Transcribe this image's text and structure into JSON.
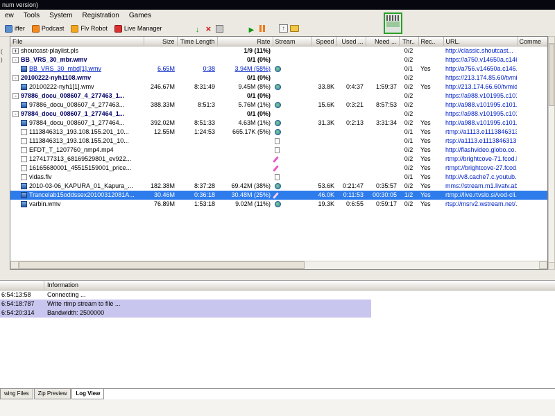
{
  "window": {
    "title": "num version)"
  },
  "menu": {
    "items": [
      "ew",
      "Tools",
      "System",
      "Registration",
      "Games"
    ]
  },
  "toolbar": {
    "text_buttons": [
      {
        "label": "iffer",
        "icon": "sniffer-icon"
      },
      {
        "label": "Podcast",
        "icon": "podcast-icon"
      },
      {
        "label": "Flv Robot",
        "icon": "flv-robot-icon"
      },
      {
        "label": "Live Manager",
        "icon": "live-manager-icon"
      }
    ],
    "icon_groups": [
      [
        "download-icon",
        "delete-icon",
        "stop-icon"
      ],
      [
        "play-icon",
        "pause-icon"
      ],
      [
        "upload-icon",
        "folder-icon"
      ]
    ]
  },
  "left_marks": [
    "(",
    ")"
  ],
  "table": {
    "columns": [
      {
        "label": "File",
        "align": "left"
      },
      {
        "label": "Size",
        "align": "right"
      },
      {
        "label": "Time Length",
        "align": "right"
      },
      {
        "label": "Rate",
        "align": "right"
      },
      {
        "label": "Stream",
        "align": "left"
      },
      {
        "label": "Speed",
        "align": "right"
      },
      {
        "label": "Used ...",
        "align": "right"
      },
      {
        "label": "Need ...",
        "align": "right"
      },
      {
        "label": "Thr..",
        "align": "center"
      },
      {
        "label": "Rec..",
        "align": "left"
      },
      {
        "label": "URL.",
        "align": "left"
      },
      {
        "label": "Comme",
        "align": "left"
      }
    ],
    "rows": [
      {
        "style": "root",
        "toggle": "+",
        "file": "shoutcast-playlist.pls",
        "rate": "1/9 (11%)",
        "thr": "0/2",
        "url": "http://classic.shoutcast..."
      },
      {
        "style": "group",
        "toggle": "-",
        "file": "BB_VRS_30_mbr.wmv",
        "rate": "0/1 (0%)",
        "thr": "0/2",
        "url": "https://a750.v14650a.c146..."
      },
      {
        "style": "link",
        "icon": "media",
        "file": "BB_VRS_30_mbd[1].wmv",
        "size": "6.65M",
        "time": "0:38",
        "rate": "3.94M (58%)",
        "stream": "globe",
        "thr": "0/1",
        "rec": "Yes",
        "url": "http://a756.v14650a.c146..."
      },
      {
        "style": "group",
        "toggle": "-",
        "file": "20100222-nyh1108.wmv",
        "rate": "0/1 (0%)",
        "thr": "0/2",
        "url": "https://213.174.85.60/tvmi..."
      },
      {
        "style": "child",
        "icon": "media",
        "file": "20100222-nyh1[1].wmv",
        "size": "246.67M",
        "time": "8:31:49",
        "rate": "9.45M (8%)",
        "stream": "globe",
        "speed": "33.8K",
        "used": "0:4:37",
        "need": "1:59:37",
        "thr": "0/2",
        "rec": "Yes",
        "url": "http://213.174.66.60/tvmid..."
      },
      {
        "style": "group",
        "toggle": "-",
        "file": "97886_docu_008607_4_277463_1...",
        "rate": "0/1 (0%)",
        "thr": "0/2",
        "url": "https://a988.v101995.c101..."
      },
      {
        "style": "child",
        "icon": "media",
        "file": "97886_docu_008607_4_277463...",
        "size": "388.33M",
        "time": "8:51:3",
        "rate": "5.76M (1%)",
        "stream": "globe",
        "speed": "15.6K",
        "used": "0:3:21",
        "need": "8:57:53",
        "thr": "0/2",
        "rec": "",
        "url": "http://a988.v101995.c101..."
      },
      {
        "style": "group",
        "toggle": "-",
        "file": "97884_docu_008607_1_277464_1...",
        "rate": "0/1 (0%)",
        "thr": "0/2",
        "url": "https://a988.v101995.c101..."
      },
      {
        "style": "child",
        "icon": "media",
        "file": "97884_docu_008607_1_277464...",
        "size": "392.02M",
        "time": "8:51:33",
        "rate": "4.63M (1%)",
        "stream": "globe",
        "speed": "31.3K",
        "used": "0:2:13",
        "need": "3:31:34",
        "thr": "0/2",
        "rec": "Yes",
        "url": "http://a988.v101995.c101..."
      },
      {
        "style": "plain",
        "icon": "doc",
        "file": "1113846313_193.108.155.201_10...",
        "size": "12.55M",
        "time": "1:24:53",
        "rate": "665.17K (5%)",
        "stream": "globe",
        "thr": "0/1",
        "rec": "Yes",
        "url": "rtmp://a1113.e1113846313..."
      },
      {
        "style": "plain",
        "icon": "doc",
        "file": "1113846313_193.108.155.201_10...",
        "stream": "doc",
        "thr": "0/1",
        "rec": "Yes",
        "url": "rtsp://a1113.e1113846313..."
      },
      {
        "style": "plain",
        "icon": "doc",
        "file": "EFDT_T_1207760_nmp4.mp4",
        "stream": "doc",
        "thr": "0/2",
        "rec": "Yes",
        "url": "http://flashvideo.globo.co..."
      },
      {
        "style": "plain",
        "icon": "doc",
        "file": "1274177313_68169529801_ev922...",
        "stream": "pen",
        "thr": "0/2",
        "rec": "Yes",
        "url": "rtmp://brightcove-71.fcod.l..."
      },
      {
        "style": "plain",
        "icon": "doc",
        "file": "16165680001_45515159001_price...",
        "stream": "pen",
        "thr": "0/2",
        "rec": "Yes",
        "url": "rtmpt://brightcove-27.fcod..."
      },
      {
        "style": "plain",
        "icon": "doc",
        "file": "vidas.flv",
        "stream": "doc",
        "thr": "0/1",
        "rec": "Yes",
        "url": "http://v8.cache7.c.youtub..."
      },
      {
        "style": "plain",
        "icon": "media",
        "file": "2010-03-06_KAPURA_01_Kapura_...",
        "size": "182.38M",
        "time": "8:37:28",
        "rate": "69.42M (38%)",
        "stream": "globe",
        "speed": "53.6K",
        "used": "0:21:47",
        "need": "0:35:57",
        "thr": "0/2",
        "rec": "Yes",
        "url": "mms://stream.m1.livatv.ab..."
      },
      {
        "style": "selected",
        "icon": "media",
        "file": "Trancelab15oddssex20100312081A...",
        "size": "30.46M",
        "time": "0:36:18",
        "rate": "30.48M (25%)",
        "stream": "pen",
        "speed": "46.0K",
        "used": "0:11:53",
        "need": "00:30:05",
        "thr": "1/2",
        "rec": "Yes",
        "url": "rtmp://live.rtvslo.si/vod-cli..."
      },
      {
        "style": "plain",
        "icon": "media",
        "file": "varbin.wmv",
        "size": "76.89M",
        "time": "1:53:18",
        "rate": "9.02M (11%)",
        "stream": "globe",
        "speed": "19.3K",
        "used": "0:6:55",
        "need": "0:59:17",
        "thr": "0/2",
        "rec": "Yes",
        "url": "rtsp://msrv2.wstream.net/..."
      }
    ]
  },
  "log": {
    "header": "Information",
    "rows": [
      {
        "time": "6:54:13:58",
        "text": "Connecting ...",
        "highlight": false
      },
      {
        "time": "6:54:18:787",
        "text": "Write rtmp stream to file ...",
        "highlight": true
      },
      {
        "time": "6:54:20:314",
        "text": "Bandwidth: 2500000",
        "highlight": true
      }
    ]
  },
  "tabs": {
    "items": [
      {
        "label": "wing Files",
        "active": false
      },
      {
        "label": "Zip Preview",
        "active": false
      },
      {
        "label": "Log View",
        "active": true
      }
    ]
  }
}
